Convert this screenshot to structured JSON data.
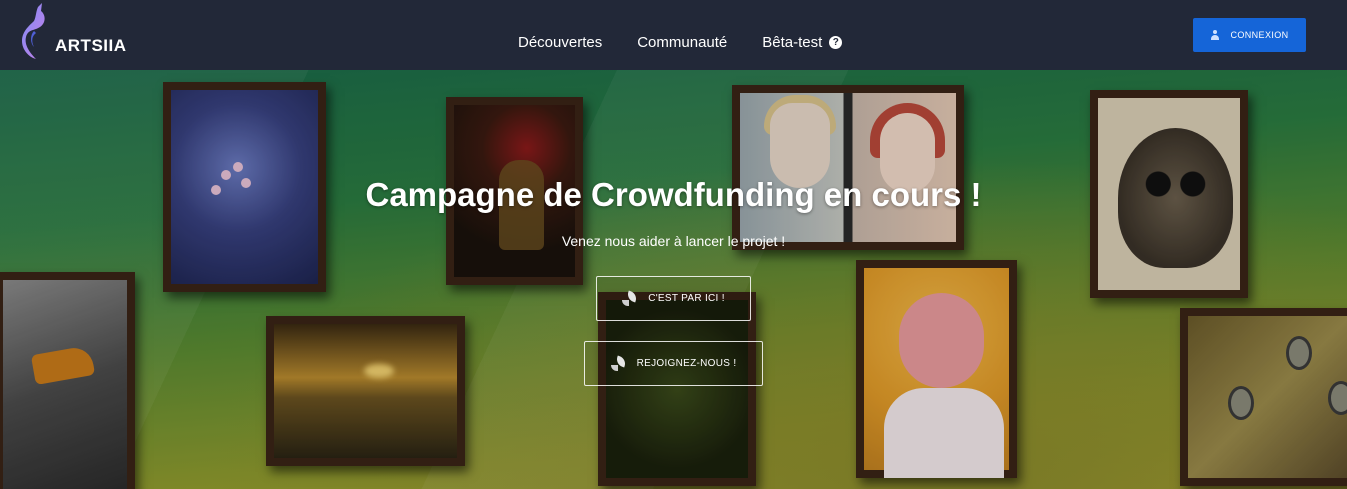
{
  "navbar": {
    "brand": "ARTSIIA",
    "links": [
      {
        "label": "Découvertes"
      },
      {
        "label": "Communauté"
      },
      {
        "label": "Bêta-test"
      }
    ],
    "login_label": "CONNEXION",
    "accent_color": "#1565d8"
  },
  "hero": {
    "title": "Campagne de Crowdfunding en cours !",
    "subtitle": "Venez nous aider à lancer le projet !",
    "cta_primary": "C'EST PAR ICI !",
    "cta_secondary": "REJOIGNEZ-NOUS !"
  },
  "icons": {
    "logo": "unicorn-logo-icon",
    "help": "question-circle-icon",
    "user": "user-icon",
    "brush": "paintbrush-icon"
  }
}
